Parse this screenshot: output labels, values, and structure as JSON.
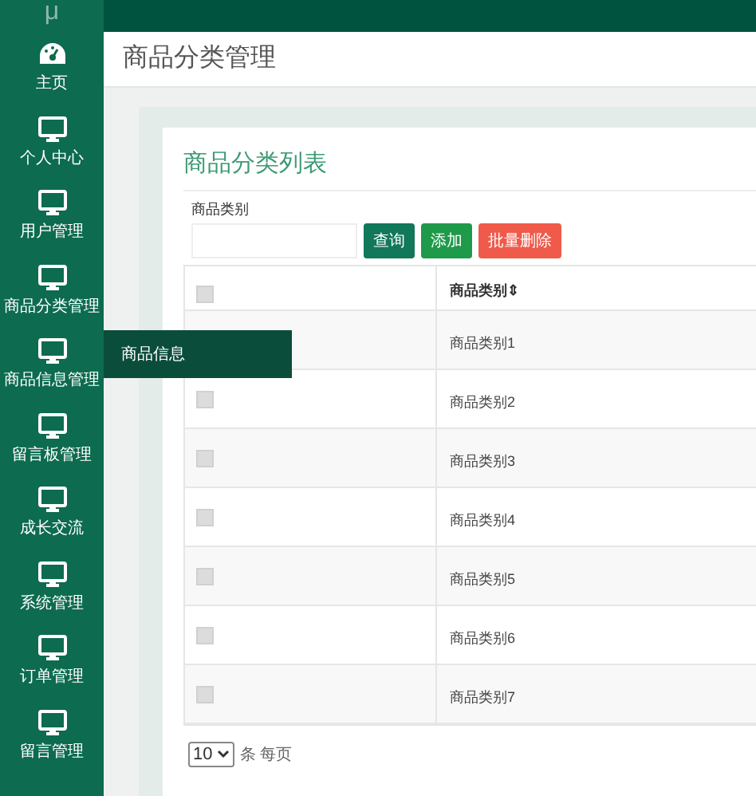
{
  "sidebar": {
    "logo": "μ",
    "items": [
      {
        "label": "主页",
        "kind": "dashboard"
      },
      {
        "label": "个人中心",
        "kind": "monitor"
      },
      {
        "label": "用户管理",
        "kind": "monitor"
      },
      {
        "label": "商品分类管理",
        "kind": "monitor"
      },
      {
        "label": "商品信息管理",
        "kind": "monitor",
        "flyout": [
          "商品信息"
        ]
      },
      {
        "label": "留言板管理",
        "kind": "monitor"
      },
      {
        "label": "成长交流",
        "kind": "monitor"
      },
      {
        "label": "系统管理",
        "kind": "monitor"
      },
      {
        "label": "订单管理",
        "kind": "monitor"
      },
      {
        "label": "留言管理",
        "kind": "monitor"
      }
    ]
  },
  "page_title": "商品分类管理",
  "card": {
    "title": "商品分类列表",
    "search": {
      "label": "商品类别"
    },
    "buttons": [
      {
        "label": "查询",
        "kind": "query"
      },
      {
        "label": "添加",
        "kind": "add"
      },
      {
        "label": "批量删除",
        "kind": "delete"
      }
    ],
    "table": {
      "header_checked": false,
      "columns": [
        "商品类别⇕"
      ],
      "rows": [
        {
          "cells": [
            "商品类别1"
          ]
        },
        {
          "checked": false,
          "cells": [
            "商品类别2"
          ]
        },
        {
          "checked": false,
          "cells": [
            "商品类别3"
          ]
        },
        {
          "checked": false,
          "cells": [
            "商品类别4"
          ]
        },
        {
          "checked": false,
          "cells": [
            "商品类别5"
          ]
        },
        {
          "checked": false,
          "cells": [
            "商品类别6"
          ]
        },
        {
          "checked": false,
          "cells": [
            "商品类别7"
          ]
        }
      ]
    },
    "pagination": {
      "page_size": "10",
      "suffix": "条 每页"
    }
  }
}
